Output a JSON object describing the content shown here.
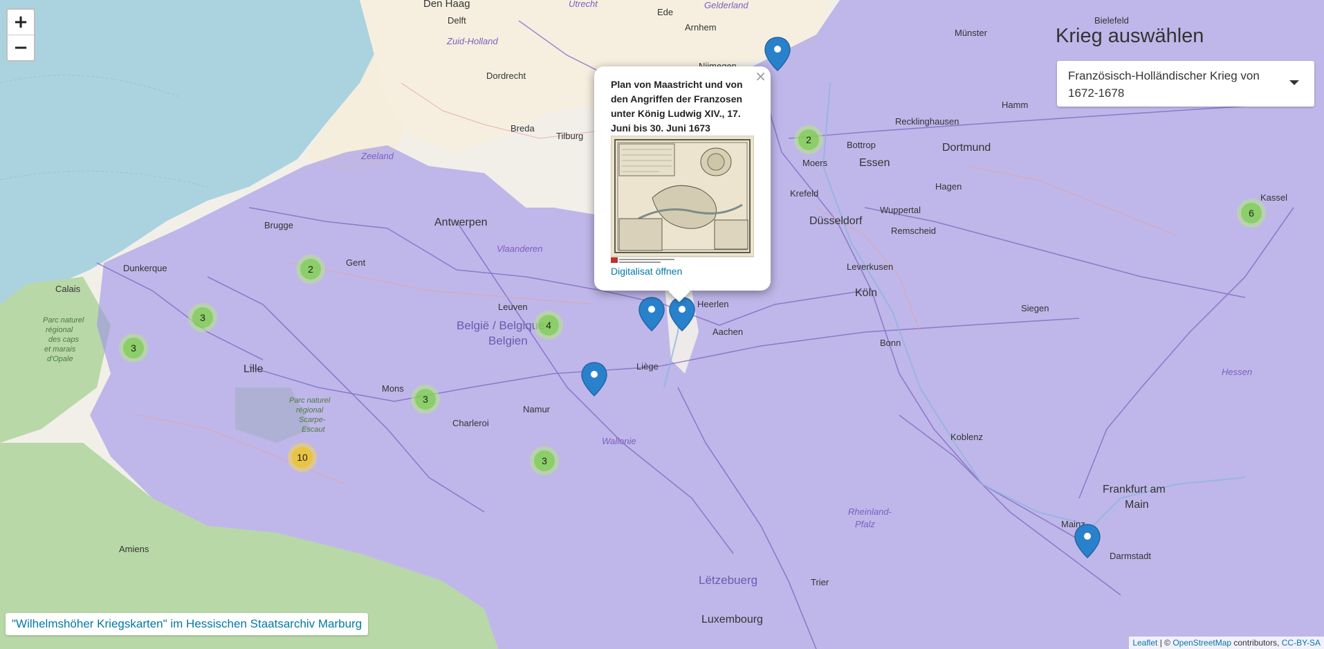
{
  "colors": {
    "sea": "#aad3df",
    "land": "#f2efe9",
    "occupation": "#9f94e8",
    "forest": "#b8d8a8",
    "marker": "#2a81cb",
    "link": "#0078a8"
  },
  "zoom": {
    "in": "+",
    "out": "−"
  },
  "sidebar": {
    "title": "Krieg auswählen",
    "selected": "Französisch-Holländischer Krieg von 1672-1678"
  },
  "popup": {
    "title": "Plan von Maastricht und von den Angriffen der Franzosen unter König Ludwig XIV., 17. Juni bis 30. Juni 1673",
    "link": "Digitalisat öffnen",
    "close": "×"
  },
  "clusters": [
    {
      "label": "2"
    },
    {
      "label": "3"
    },
    {
      "label": "3"
    },
    {
      "label": "4"
    },
    {
      "label": "3"
    },
    {
      "label": "10"
    },
    {
      "label": "3"
    },
    {
      "label": "2"
    },
    {
      "label": "6"
    }
  ],
  "map_labels": {
    "den_haag": "Den Haag",
    "utrecht": "Utrecht",
    "ede": "Ede",
    "gelderland": "Gelderland",
    "delft": "Delft",
    "arnhem": "Arnhem",
    "zuid_holland": "Zuid-Holland",
    "dordrecht": "Dordrecht",
    "nijmegen": "Nijmegen",
    "breda": "Breda",
    "tilburg": "Tilburg",
    "zeeland": "Zeeland",
    "antwerpen": "Antwerpen",
    "vlaanderen": "Vlaanderen",
    "brugge": "Brugge",
    "gent": "Gent",
    "dunkerque": "Dunkerque",
    "calais": "Calais",
    "leuven": "Leuven",
    "belgie": "België / Belgique /",
    "belgien": "Belgien",
    "lille": "Lille",
    "mons": "Mons",
    "charleroi": "Charleroi",
    "namur": "Namur",
    "liege": "Liège",
    "heerlen": "Heerlen",
    "aachen": "Aachen",
    "wallonie": "Wallonie",
    "parc_opale_1": "Parc naturel",
    "parc_opale_2": "régional",
    "parc_opale_3": "des caps",
    "parc_opale_4": "et marais",
    "parc_opale_5": "d'Opale",
    "parc_scarpe_1": "Parc naturel",
    "parc_scarpe_2": "régional",
    "parc_scarpe_3": "Scarpe-",
    "parc_scarpe_4": "Escaut",
    "amiens": "Amiens",
    "letzebuerg": "Lëtzebuerg",
    "luxembourg": "Luxembourg",
    "trier": "Trier",
    "rheinland_pfalz_1": "Rheinland-",
    "rheinland_pfalz_2": "Pfalz",
    "koblenz": "Koblenz",
    "bonn": "Bonn",
    "koln": "Köln",
    "leverkusen": "Leverkusen",
    "dusseldorf": "Düsseldorf",
    "remscheid": "Remscheid",
    "wuppertal": "Wuppertal",
    "krefeld": "Krefeld",
    "moers": "Moers",
    "essen": "Essen",
    "bottrop": "Bottrop",
    "recklinghausen": "Recklinghausen",
    "dortmund": "Dortmund",
    "hagen": "Hagen",
    "hamm": "Hamm",
    "munster": "Münster",
    "bielefeld": "Bielefeld",
    "siegen": "Siegen",
    "hessen": "Hessen",
    "kassel": "Kassel",
    "frankfurt_1": "Frankfurt am",
    "frankfurt_2": "Main",
    "mainz": "Mainz",
    "darmstadt": "Darmstadt"
  },
  "footer": {
    "title_link": "\"Wilhelmshöher Kriegskarten\" im Hessischen Staatsarchiv Marburg",
    "attr_leaflet": "Leaflet",
    "attr_sep": " | © ",
    "attr_osm": "OpenStreetMap",
    "attr_contrib": " contributors, ",
    "attr_license": "CC-BY-SA"
  }
}
